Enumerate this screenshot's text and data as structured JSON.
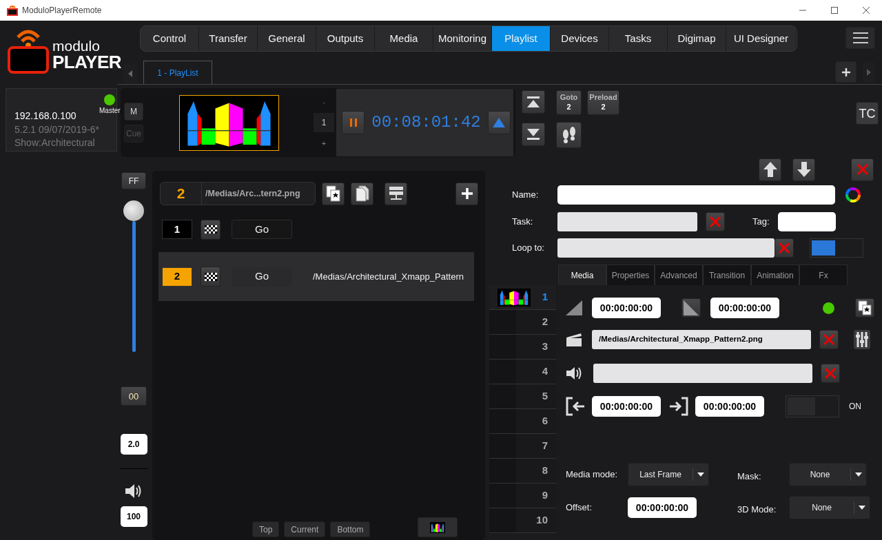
{
  "window": {
    "title": "ModuloPlayerRemote"
  },
  "logo": {
    "line_1": "modulo",
    "line_2": "PLAYER"
  },
  "server": {
    "ip": "192.168.0.100",
    "version": "5.2.1 09/07/2019-6*",
    "show": "Show:Architectural",
    "role": "Master",
    "online": true
  },
  "nav_tabs": [
    {
      "label": "Control",
      "selected": false
    },
    {
      "label": "Transfer",
      "selected": false
    },
    {
      "label": "General",
      "selected": false
    },
    {
      "label": "Outputs",
      "selected": false
    },
    {
      "label": "Media",
      "selected": false
    },
    {
      "label": "Monitoring",
      "selected": false
    },
    {
      "label": "Playlist",
      "selected": true
    },
    {
      "label": "Devices",
      "selected": false
    },
    {
      "label": "Tasks",
      "selected": false
    },
    {
      "label": "Digimap",
      "selected": false
    },
    {
      "label": "UI Designer",
      "selected": false
    }
  ],
  "playlist_tabs": [
    {
      "label": "1 - PlayList",
      "selected": true
    }
  ],
  "transport": {
    "modes": [
      {
        "label": "M",
        "disabled": false
      },
      {
        "label": "Cue",
        "disabled": true
      }
    ],
    "step_minus": "-",
    "step_value": "1",
    "step_plus": "+",
    "timecode": "00:08:01:42",
    "goto_label": "Goto",
    "goto_value": "2",
    "preload_label": "Preload",
    "preload_value": "2",
    "tc_label": "TC"
  },
  "speed": {
    "ff_label": "FF",
    "level": 1.0,
    "reset_label": "00",
    "rate": "2.0",
    "volume": "100"
  },
  "playlist": {
    "current_number": "2",
    "current_path": "/Medias/Arc...tern2.png",
    "cues": [
      {
        "number": "1",
        "go": "Go",
        "selected": false
      },
      {
        "number": "2",
        "go": "Go",
        "path": "/Medias/Architectural_Xmapp_Pattern",
        "selected": true
      }
    ],
    "scroll_buttons": [
      "Top",
      "Current",
      "Bottom"
    ]
  },
  "cue_editor": {
    "name_label": "Name:",
    "task_label": "Task:",
    "tag_label": "Tag:",
    "loop_label": "Loop to:",
    "loop_on": true,
    "tabs": [
      {
        "label": "Media",
        "selected": true
      },
      {
        "label": "Properties",
        "selected": false
      },
      {
        "label": "Advanced",
        "selected": false
      },
      {
        "label": "Transition",
        "selected": false
      },
      {
        "label": "Animation",
        "selected": false
      },
      {
        "label": "Fx",
        "selected": false
      }
    ],
    "layers": [
      {
        "number": "1",
        "kind": "media",
        "selected": true
      },
      {
        "number": "2",
        "kind": "empty",
        "selected": false
      },
      {
        "number": "3",
        "kind": "empty",
        "selected": false
      },
      {
        "number": "4",
        "kind": "empty",
        "selected": false
      },
      {
        "number": "5",
        "kind": "empty",
        "selected": false
      },
      {
        "number": "6",
        "kind": "empty",
        "selected": false
      },
      {
        "number": "7",
        "kind": "empty",
        "selected": false
      },
      {
        "number": "8",
        "kind": "empty",
        "selected": false
      },
      {
        "number": "9",
        "kind": "empty",
        "selected": false
      },
      {
        "number": "10",
        "kind": "empty",
        "selected": false
      }
    ],
    "media": {
      "fade_in": "00:00:00:00",
      "fade_out": "00:00:00:00",
      "active": true,
      "file": "/Medias/Architectural_Xmapp_Pattern2.png",
      "in_point": "00:00:00:00",
      "out_point": "00:00:00:00",
      "switch_label": "ON",
      "switch_on": false,
      "media_mode_label": "Media mode:",
      "media_mode": "Last Frame",
      "mask_label": "Mask:",
      "mask": "None",
      "offset_label": "Offset:",
      "offset": "00:00:00:00",
      "mode_3d_label": "3D Mode:",
      "mode_3d": "None"
    }
  }
}
